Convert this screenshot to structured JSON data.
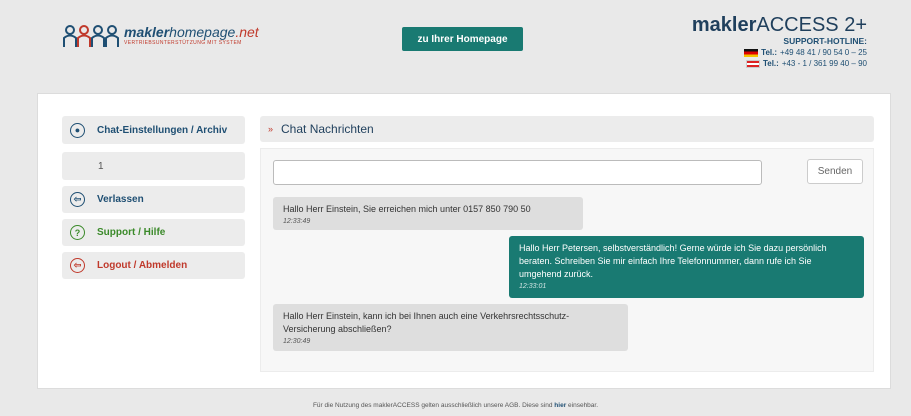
{
  "header": {
    "logo": {
      "name_bold": "makler",
      "name_rest": "homepage",
      "name_tld": ".net",
      "tagline": "VERTRIEBSUNTERSTÜTZUNG MIT SYSTEM"
    },
    "homepage_button": "zu Ihrer Homepage",
    "brand": {
      "title_bold": "makler",
      "title_rest": "ACCESS 2+",
      "hotline": "SUPPORT-HOTLINE:",
      "tel_label": "Tel.:",
      "tel_de": "+49 48 41 / 90 54 0 – 25",
      "tel_at": "+43 - 1 / 361 99 40 – 90"
    }
  },
  "sidebar": {
    "settings_label": "Chat-Einstellungen / Archiv",
    "counter": "1",
    "items": [
      {
        "label": "Verlassen",
        "color": "#1f4f73"
      },
      {
        "label": "Support / Hilfe",
        "color": "#3b8a2a"
      },
      {
        "label": "Logout / Abmelden",
        "color": "#c0392b"
      }
    ]
  },
  "chat": {
    "title": "Chat Nachrichten",
    "input_value": "",
    "send_label": "Senden",
    "messages": [
      {
        "text": "Hallo Herr Einstein, Sie erreichen mich unter 0157 850 790 50",
        "time": "12:33:49"
      },
      {
        "text": "Hallo Herr Petersen, selbstverständlich! Gerne würde ich Sie dazu persönlich beraten. Schreiben Sie mir einfach Ihre Telefonnummer, dann rufe ich Sie umgehend zurück.",
        "time": "12:33:01"
      },
      {
        "text": "Hallo Herr Einstein, kann ich bei Ihnen auch eine Verkehrsrechtsschutz-Versicherung abschließen?",
        "time": "12:30:49"
      }
    ]
  },
  "footer": {
    "text_before": "Für die Nutzung des maklerACCESS gelten ausschließlich unsere AGB. Diese sind ",
    "link": "hier",
    "text_after": " einsehbar."
  },
  "colors": {
    "accent": "#197a72",
    "brand_blue": "#1f4f73",
    "red": "#c0392b",
    "green": "#3b8a2a"
  }
}
